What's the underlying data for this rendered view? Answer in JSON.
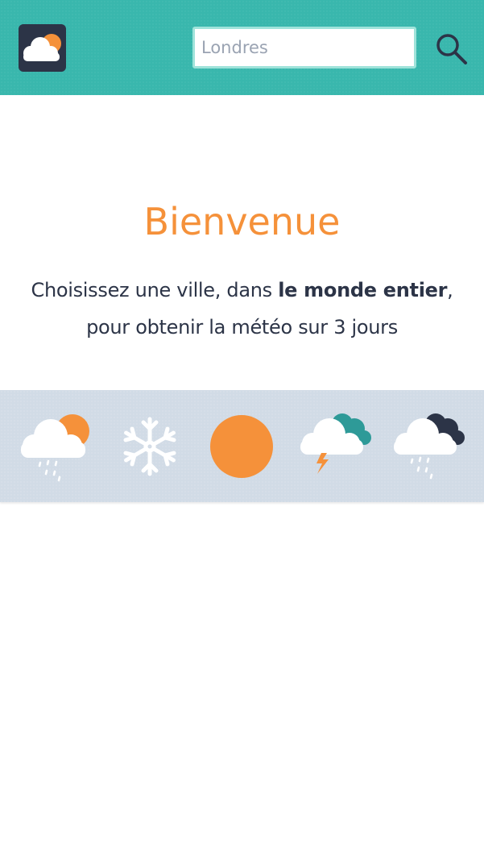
{
  "header": {
    "logo_icon": "cloud-sun-icon",
    "search": {
      "placeholder": "Londres",
      "value": ""
    },
    "search_icon": "search-icon"
  },
  "main": {
    "title": "Bienvenue",
    "subtitle_part1": "Choisissez une ville, dans ",
    "subtitle_bold": "le monde entier",
    "subtitle_part2": ",",
    "subtitle_line2": "pour obtenir la météo sur 3 jours"
  },
  "weather_icons": [
    "sun-cloud-rain-icon",
    "snowflake-icon",
    "sun-icon",
    "storm-cloud-lightning-icon",
    "dark-cloud-rain-icon"
  ],
  "colors": {
    "header": "#39b7ad",
    "accent": "#f5913a",
    "text": "#2c3447",
    "band": "#d1dbe6",
    "input_border": "#9fe3da",
    "teal_cloud": "#2e9a98",
    "dark_cloud": "#2c3447"
  }
}
